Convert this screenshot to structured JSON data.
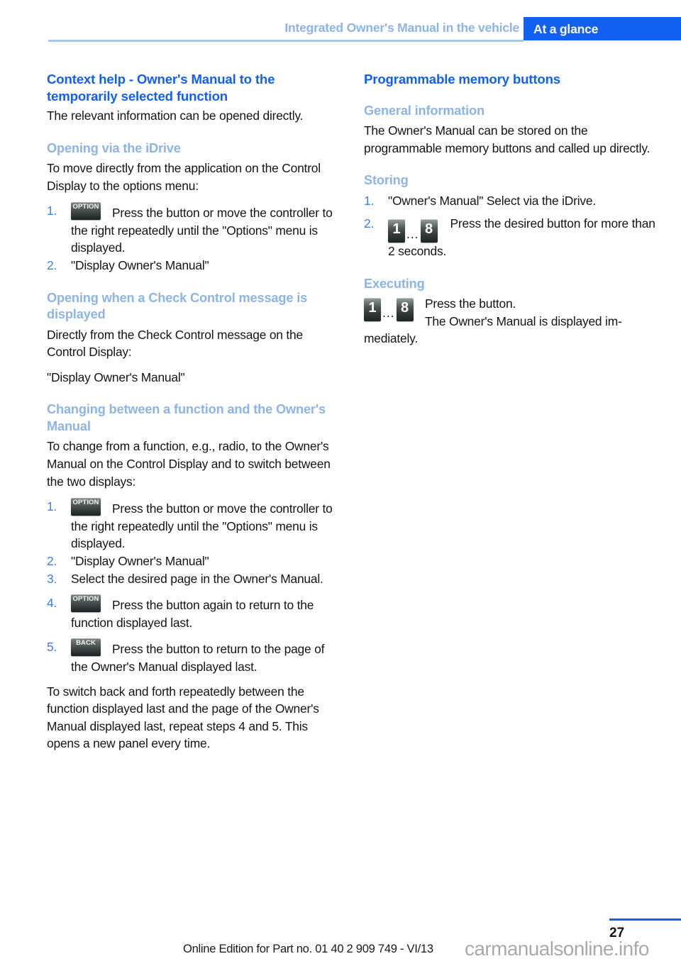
{
  "header": {
    "breadcrumb": "Integrated Owner's Manual in the vehicle",
    "section_tab": "At a glance",
    "accent_blue": "#1260f0",
    "light_blue": "#8db4e8"
  },
  "left_column": {
    "title": "Context help - Owner's Manual to the temporarily selected function",
    "intro": "The relevant information can be opened directly.",
    "section_idrive": {
      "heading": "Opening via the iDrive",
      "lead": "To move directly from the application on the Control Display to the options menu:",
      "steps": [
        {
          "num": "1.",
          "icon": "OPTION",
          "text": "Press the button or move the controller to the right repeatedly until the \"Options\" menu is displayed."
        },
        {
          "num": "2.",
          "icon": null,
          "text": "\"Display Owner's Manual\""
        }
      ]
    },
    "section_check_control": {
      "heading": "Opening when a Check Control message is displayed",
      "lead": "Directly from the Check Control message on the Control Display:",
      "body": "\"Display Owner's Manual\""
    },
    "section_changing": {
      "heading": "Changing between a function and the Owner's Manual",
      "lead": "To change from a function, e.g., radio, to the Owner's Manual on the Control Display and to switch between the two displays:",
      "steps": [
        {
          "num": "1.",
          "icon": "OPTION",
          "text": "Press the button or move the controller to the right repeatedly until the \"Options\" menu is displayed."
        },
        {
          "num": "2.",
          "icon": null,
          "text": "\"Display Owner's Manual\""
        },
        {
          "num": "3.",
          "icon": null,
          "text": "Select the desired page in the Owner's Manual."
        },
        {
          "num": "4.",
          "icon": "OPTION",
          "text": "Press the button again to return to the function displayed last."
        },
        {
          "num": "5.",
          "icon": "BACK",
          "text": "Press the button to return to the page of the Owner's Manual displayed last."
        }
      ],
      "closing": "To switch back and forth repeatedly between the function displayed last and the page of the Owner's Manual displayed last, repeat steps 4 and 5. This opens a new panel every time."
    }
  },
  "right_column": {
    "title": "Programmable memory buttons",
    "section_general": {
      "heading": "General information",
      "body": "The Owner's Manual can be stored on the programmable memory buttons and called up directly."
    },
    "section_storing": {
      "heading": "Storing",
      "steps": [
        {
          "num": "1.",
          "icon": null,
          "text": "\"Owner's Manual\" Select via the iDrive."
        },
        {
          "num": "2.",
          "icon": "memory",
          "text": "Press the desired button for more than 2 seconds."
        }
      ]
    },
    "section_executing": {
      "heading": "Executing",
      "line1": "Press the button.",
      "line2": "The Owner's Manual is displayed im-",
      "line3": "mediately."
    }
  },
  "memory_icon": {
    "first": "1",
    "dots": "...",
    "last": "8"
  },
  "footer": {
    "page_number": "27",
    "edition": "Online Edition for Part no. 01 40 2 909 749 - VI/13",
    "watermark": "carmanualsonline.info"
  }
}
